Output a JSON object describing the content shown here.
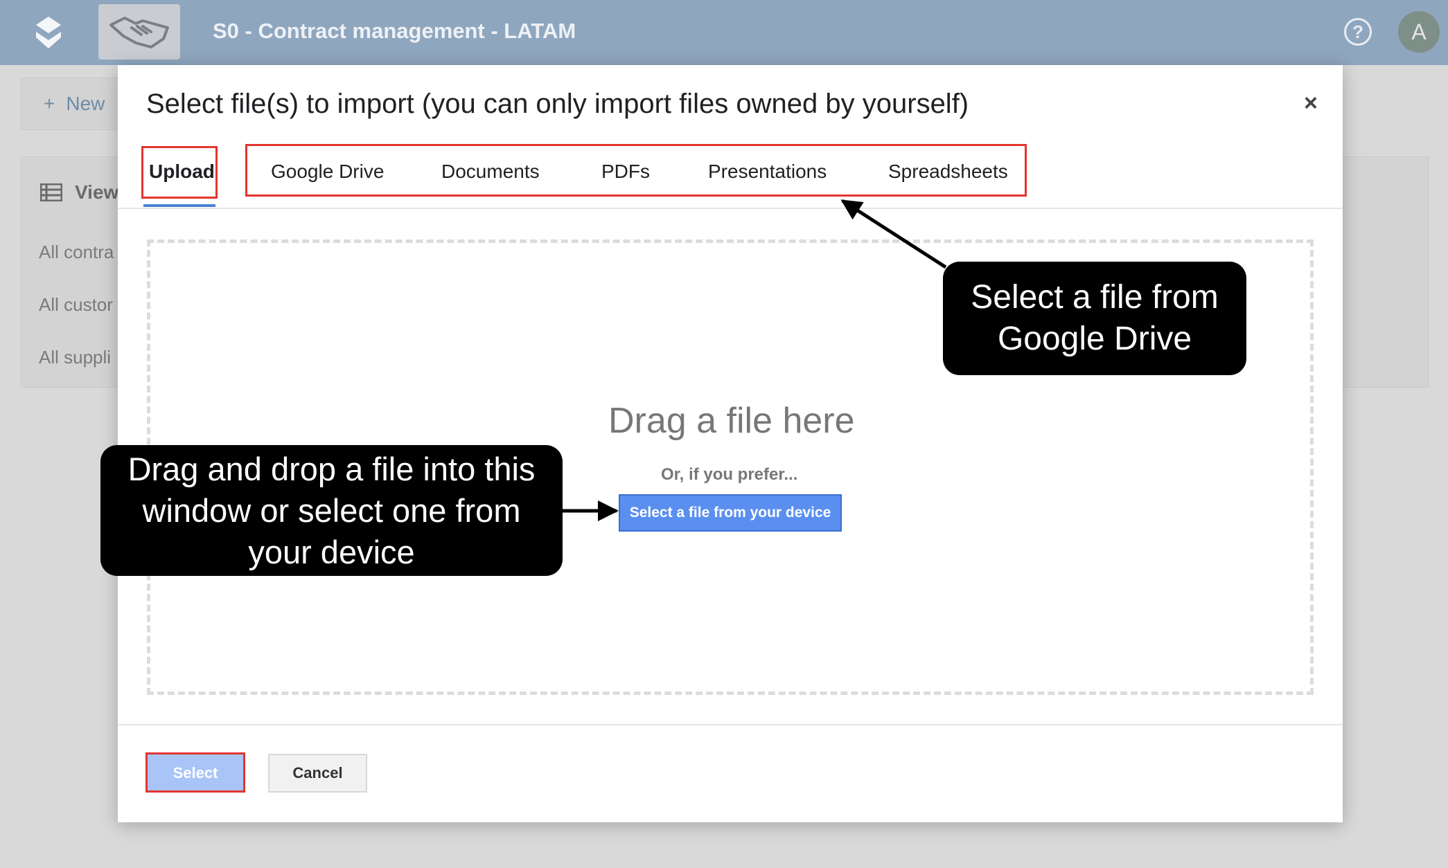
{
  "app": {
    "title": "S0 - Contract management - LATAM",
    "avatar_initial": "A",
    "help_glyph": "?"
  },
  "toolbar": {
    "new_plus": "+",
    "new_label": "New"
  },
  "views": {
    "header": "View",
    "items": [
      "All contra",
      "All custor",
      "All suppli"
    ]
  },
  "modal": {
    "title": "Select file(s) to import (you can only import files owned by yourself)",
    "close_glyph": "×",
    "tabs": [
      "Upload",
      "Google Drive",
      "Documents",
      "PDFs",
      "Presentations",
      "Spreadsheets"
    ],
    "active_tab": "Upload",
    "drag_text": "Drag a file here",
    "prefer_text": "Or, if you prefer...",
    "device_button": "Select a file from your device",
    "select_button": "Select",
    "cancel_button": "Cancel"
  },
  "annotations": {
    "drive_callout": "Select a file from Google Drive",
    "drag_callout": "Drag and drop a file into this window or select one from your device",
    "highlight_color": "#e3342f"
  }
}
